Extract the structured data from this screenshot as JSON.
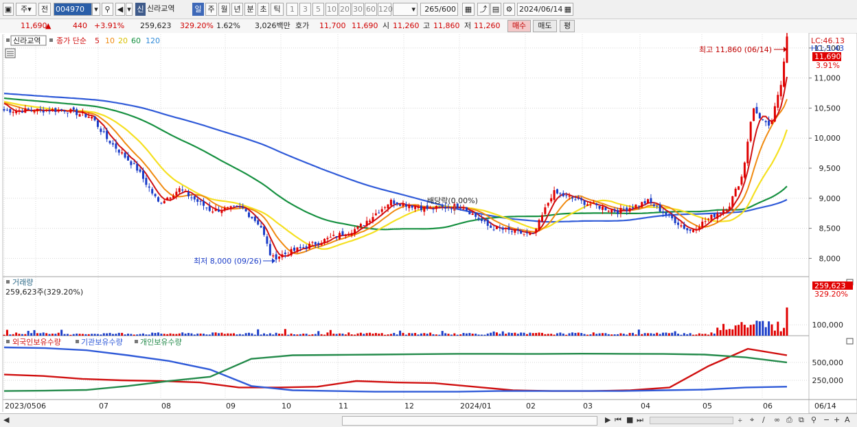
{
  "toolbar": {
    "period_main": "주",
    "prev_label": "전",
    "stock_code": "004970",
    "market_badge": "신",
    "stock_name": "신라교역",
    "periods": [
      "일",
      "주",
      "월",
      "년",
      "분",
      "초",
      "틱"
    ],
    "active_period": "일",
    "intervals": [
      "1",
      "3",
      "5",
      "10",
      "20",
      "30",
      "60",
      "120"
    ],
    "bar_count": "265",
    "bar_max": "/600",
    "date": "2024/06/14"
  },
  "quote": {
    "price": "11,690",
    "change": "440",
    "change_pct": "+3.91%",
    "volume": "259,623",
    "volume_ratio": "329.20%",
    "turnover": "1.62%",
    "amount": "3,026백만",
    "bid_label": "호가",
    "ask": "11,700",
    "bid": "11,690",
    "open_label": "시",
    "open": "11,260",
    "high_label": "고",
    "high": "11,860",
    "low_label": "저",
    "low": "11,260",
    "buy_label": "매수",
    "sell_label": "매도",
    "flat_label": "평"
  },
  "legend": {
    "stock": "신라교역",
    "ma_prefix": "종가 단순",
    "ma_periods": [
      "5",
      "10",
      "20",
      "60",
      "120"
    ],
    "volume_title": "거래량",
    "volume_value": "259,623주(329.20%)",
    "holdings": [
      "외국인보유수량",
      "기관보유수량",
      "개인보유수량"
    ]
  },
  "annotations": {
    "high": "최고 11,860 (06/14)",
    "low": "최저 8,000 (09/26)",
    "dividend": "배당락(0.00%)",
    "lc": "LC:46.13",
    "hc": "HC:-1.43",
    "last_price": "11,690",
    "last_pct": "3.91%",
    "last_volume": "259,623",
    "last_volume_pct": "329.20%"
  },
  "colors": {
    "up": "#e00000",
    "down": "#1a3cc8",
    "ma5": "#d01010",
    "ma10": "#f08a10",
    "ma20": "#f5e020",
    "ma60": "#169040",
    "ma120": "#2f5ad8",
    "foreign": "#d01010",
    "institution": "#2f5ad8",
    "individual": "#238a4a"
  },
  "chart_data": [
    {
      "type": "candlestick",
      "title": "신라교역",
      "x_axis_labels": [
        "2023/05",
        "06",
        "07",
        "08",
        "09",
        "10",
        "11",
        "12",
        "2024/01",
        "02",
        "03",
        "04",
        "05",
        "06",
        "06/14"
      ],
      "y_axis_ticks": [
        8000,
        8500,
        9000,
        9500,
        10000,
        10500,
        11000,
        11500
      ],
      "ylim": [
        7730,
        11750
      ],
      "series_names": [
        "5",
        "10",
        "20",
        "60",
        "120"
      ],
      "close_path": [
        {
          "date": "2023/05/25",
          "close": 10460
        },
        {
          "date": "2023/06/15",
          "close": 10470
        },
        {
          "date": "2023/06/28",
          "close": 10350
        },
        {
          "date": "2023/07/05",
          "close": 10000
        },
        {
          "date": "2023/07/20",
          "close": 9500
        },
        {
          "date": "2023/07/31",
          "close": 8920
        },
        {
          "date": "2023/08/10",
          "close": 9150
        },
        {
          "date": "2023/08/25",
          "close": 8800
        },
        {
          "date": "2023/09/10",
          "close": 8840
        },
        {
          "date": "2023/09/20",
          "close": 8550
        },
        {
          "date": "2023/09/26",
          "close": 8000
        },
        {
          "date": "2023/10/15",
          "close": 8200
        },
        {
          "date": "2023/11/10",
          "close": 8500
        },
        {
          "date": "2023/11/25",
          "close": 8950
        },
        {
          "date": "2023/12/15",
          "close": 8820
        },
        {
          "date": "2024/01/02",
          "close": 8880
        },
        {
          "date": "2024/01/15",
          "close": 8520
        },
        {
          "date": "2024/02/05",
          "close": 8380
        },
        {
          "date": "2024/02/15",
          "close": 9100
        },
        {
          "date": "2024/03/05",
          "close": 8900
        },
        {
          "date": "2024/03/20",
          "close": 8780
        },
        {
          "date": "2024/04/05",
          "close": 8950
        },
        {
          "date": "2024/04/25",
          "close": 8450
        },
        {
          "date": "2024/05/15",
          "close": 8880
        },
        {
          "date": "2024/05/22",
          "close": 9400
        },
        {
          "date": "2024/05/27",
          "close": 10500
        },
        {
          "date": "2024/06/05",
          "close": 10150
        },
        {
          "date": "2024/06/11",
          "close": 10900
        },
        {
          "date": "2024/06/14",
          "close": 11690
        }
      ],
      "ma_end_values": {
        "5": 11100,
        "10": 10700,
        "20": 10420,
        "60": 9330,
        "120": 9020
      },
      "high": {
        "date": "2024/06/14",
        "value": 11860
      },
      "low": {
        "date": "2023/09/26",
        "value": 8000
      }
    },
    {
      "type": "bar",
      "title": "거래량",
      "y_axis_ticks": [
        100000
      ],
      "last_value": 259623,
      "last_ratio_pct": 329.2
    },
    {
      "type": "line",
      "series": [
        {
          "name": "외국인보유수량",
          "values": [
            330000,
            310000,
            270000,
            250000,
            240000,
            220000,
            150000,
            150000,
            160000,
            240000,
            220000,
            210000,
            160000,
            110000,
            100000,
            100000,
            110000,
            150000,
            450000,
            690000,
            600000
          ]
        },
        {
          "name": "기관보유수량",
          "values": [
            710000,
            700000,
            670000,
            600000,
            520000,
            400000,
            170000,
            110000,
            100000,
            90000,
            90000,
            90000,
            100000,
            100000,
            100000,
            100000,
            110000,
            120000,
            150000,
            160000
          ]
        },
        {
          "name": "개인보유수량",
          "values": [
            100000,
            105000,
            115000,
            170000,
            240000,
            300000,
            550000,
            600000,
            605000,
            610000,
            615000,
            620000,
            620000,
            618000,
            622000,
            620000,
            618000,
            610000,
            570000,
            500000
          ]
        }
      ],
      "y_axis_ticks": [
        250000,
        500000
      ]
    }
  ]
}
